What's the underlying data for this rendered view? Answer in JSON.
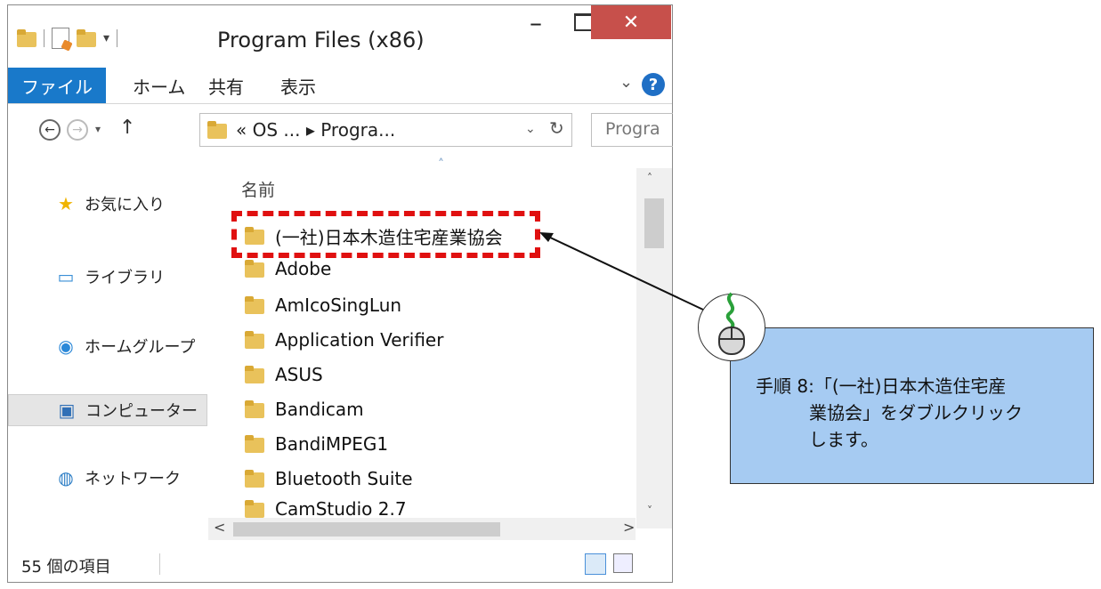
{
  "window": {
    "title": "Program Files (x86)",
    "minimize_glyph": "–",
    "close_glyph": "✕"
  },
  "ribbon": {
    "tabs": [
      "ファイル",
      "ホーム",
      "共有",
      "表示"
    ],
    "expand_glyph": "⌄",
    "help_glyph": "?"
  },
  "address": {
    "back_glyph": "←",
    "forward_glyph": "→",
    "recent_glyph": "▾",
    "up_glyph": "↑",
    "path": "« OS ... ▸ Progra...",
    "dropdown_glyph": "⌄",
    "refresh_glyph": "↻",
    "search_placeholder": "Progra"
  },
  "navigation": {
    "items": [
      {
        "label": "お気に入り",
        "icon": "star-icon",
        "glyph": "★"
      },
      {
        "label": "ライブラリ",
        "icon": "library-icon",
        "glyph": "▭"
      },
      {
        "label": "ホームグループ",
        "icon": "homegroup-icon",
        "glyph": "◉"
      },
      {
        "label": "コンピューター",
        "icon": "computer-icon",
        "glyph": "▣"
      },
      {
        "label": "ネットワーク",
        "icon": "network-icon",
        "glyph": "◍"
      }
    ]
  },
  "files": {
    "column_name": "名前",
    "sort_glyph": "˄",
    "items": [
      "(一社)日本木造住宅産業協会",
      "Adobe",
      "AmIcoSingLun",
      "Application Verifier",
      "ASUS",
      "Bandicam",
      "BandiMPEG1",
      "Bluetooth Suite",
      "CamStudio 2.7"
    ]
  },
  "scroll": {
    "up_glyph": "˄",
    "down_glyph": "˅",
    "left_glyph": "<",
    "right_glyph": ">"
  },
  "status": {
    "item_count": "55 個の項目"
  },
  "callout": {
    "text": "手順 8:「(一社)日本木造住宅産\n　　　業協会」をダブルクリック\n　　　します。"
  },
  "colors": {
    "highlight": "#e01010",
    "callout_bg": "#a6cbf2",
    "file_tab": "#1979ca",
    "close_button": "#c7504b"
  }
}
